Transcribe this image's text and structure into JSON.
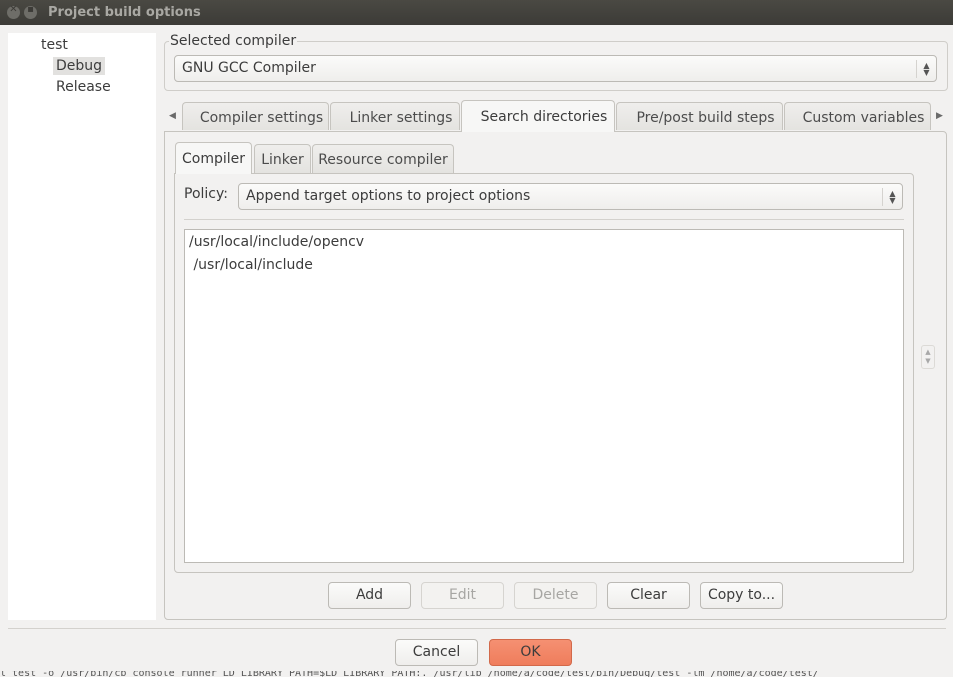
{
  "window": {
    "title": "Project build options",
    "close_icon": "close-icon",
    "minimize_icon": "minimize-icon"
  },
  "tree": {
    "root": "test",
    "targets": [
      "Debug",
      "Release"
    ],
    "selected": "Debug"
  },
  "compiler_group": {
    "label": "Selected compiler",
    "selected_compiler": "GNU GCC Compiler"
  },
  "main_tabs": [
    {
      "label": "Compiler settings",
      "active": false
    },
    {
      "label": "Linker settings",
      "active": false
    },
    {
      "label": "Search directories",
      "active": true
    },
    {
      "label": "Pre/post build steps",
      "active": false
    },
    {
      "label": "Custom variables",
      "active": false
    }
  ],
  "sub_tabs": [
    {
      "label": "Compiler",
      "active": true
    },
    {
      "label": "Linker",
      "active": false
    },
    {
      "label": "Resource compiler",
      "active": false
    }
  ],
  "policy": {
    "label": "Policy:",
    "value": "Append target options to project options"
  },
  "directories": [
    "/usr/local/include/opencv",
    " /usr/local/include"
  ],
  "list_buttons": [
    {
      "label": "Add",
      "enabled": true
    },
    {
      "label": "Edit",
      "enabled": false
    },
    {
      "label": "Delete",
      "enabled": false
    },
    {
      "label": "Clear",
      "enabled": true
    },
    {
      "label": "Copy to...",
      "enabled": true
    }
  ],
  "dialog_buttons": {
    "cancel": "Cancel",
    "ok": "OK"
  },
  "colors": {
    "ok_button": "#ef7d5c",
    "titlebar": "#3c3b37"
  },
  "background_text": "l test  -o /usr/bin/cb_console_runner LD_LIBRARY_PATH=$LD_LIBRARY_PATH:. /usr/lib  /home/a/code/test/bin/Debug/test  -lm  /home/a/code/test/"
}
